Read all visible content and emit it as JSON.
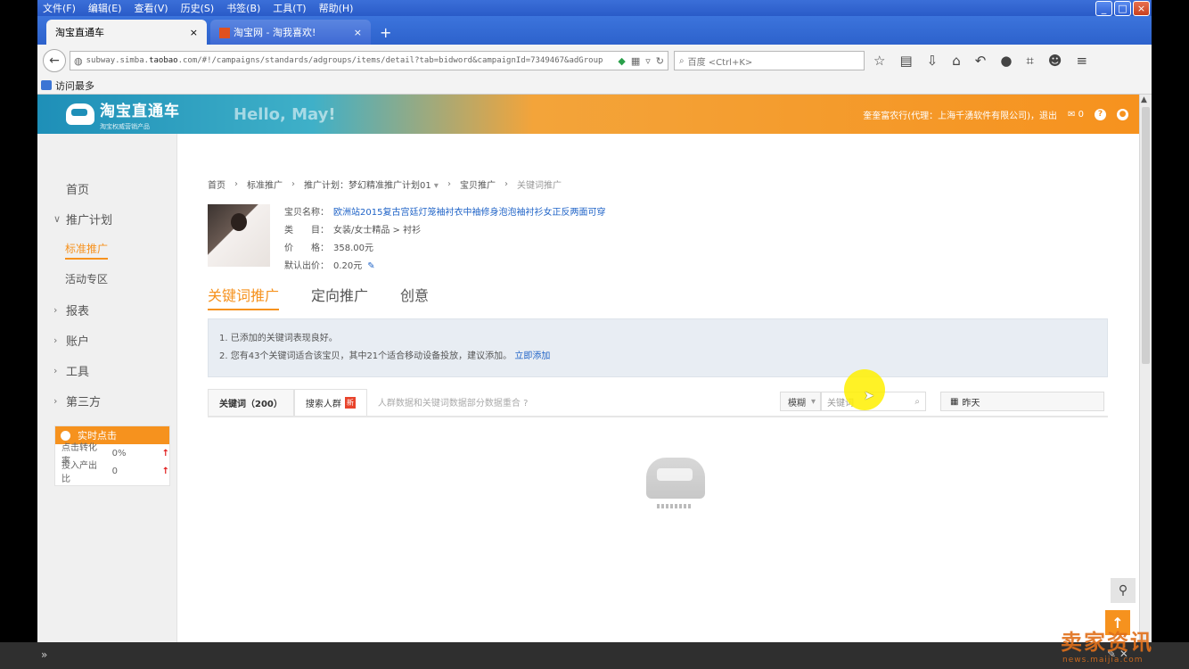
{
  "browser": {
    "menu": [
      "文件(F)",
      "编辑(E)",
      "查看(V)",
      "历史(S)",
      "书签(B)",
      "工具(T)",
      "帮助(H)"
    ],
    "tabs": [
      {
        "title": "淘宝直通车",
        "close": "×"
      },
      {
        "title": "淘宝网 - 淘我喜欢!",
        "close": "×"
      }
    ],
    "new_tab": "+",
    "url_host_prefix": "subway.simba.",
    "url_host": "taobao",
    "url_rest": ".com/#!/campaigns/standards/adgroups/items/detail?tab=bidword&campaignId=7349467&adGroup",
    "search_placeholder": "百度 <Ctrl+K>",
    "bookmark": "访问最多",
    "win_controls": [
      "_",
      "□",
      "×"
    ]
  },
  "header": {
    "logo_title": "淘宝直通车",
    "logo_sub": "淘宝权威营销产品",
    "greeting": "Hello, May!",
    "account": "奎奎富农行(代理：上海千湧软件有限公司)，退出",
    "mail_count": "0",
    "help": "?"
  },
  "sidebar": {
    "home": "首页",
    "campaign": "推广计划",
    "standard": "标准推广",
    "activity": "活动专区",
    "report": "报表",
    "account": "账户",
    "tools": "工具",
    "third_party": "第三方",
    "realtime": {
      "title": "实时点击",
      "rows": [
        {
          "label": "点击转化率",
          "value": "0%",
          "trend": "↑"
        },
        {
          "label": "投入产出比",
          "value": "0",
          "trend": "↑"
        }
      ]
    }
  },
  "breadcrumb": {
    "home": "首页",
    "standard": "标准推广",
    "plan_label": "推广计划：",
    "plan_name": "梦幻精准推广计划01",
    "item": "宝贝推广",
    "current": "关键词推广",
    "sep": "›"
  },
  "product": {
    "name_label": "宝贝名称：",
    "name": "欧洲站2015复古宫廷灯笼袖衬衣中袖修身泡泡袖衬衫女正反两面可穿",
    "category_label": "类　　目：",
    "category": "女装/女士精品 > 衬衫",
    "price_label": "价　　格：",
    "price": "358.00元",
    "bid_label": "默认出价：",
    "bid": "0.20元"
  },
  "promo_tabs": [
    "关键词推广",
    "定向推广",
    "创意"
  ],
  "notice": {
    "line1": "1. 已添加的关键词表现良好。",
    "line2": "2. 您有43个关键词适合该宝贝，其中21个适合移动设备投放，建议添加。",
    "line2_link": "立即添加"
  },
  "list_tabs": {
    "keywords": "关键词（200）",
    "crowd": "搜索人群",
    "crowd_badge": "新",
    "note": "人群数据和关键词数据部分数据重合"
  },
  "filters": {
    "match": "模糊",
    "keyword_placeholder": "关键词",
    "date": "昨天"
  },
  "watermark": {
    "text": "卖家资讯",
    "url": "news.maijia.com"
  }
}
